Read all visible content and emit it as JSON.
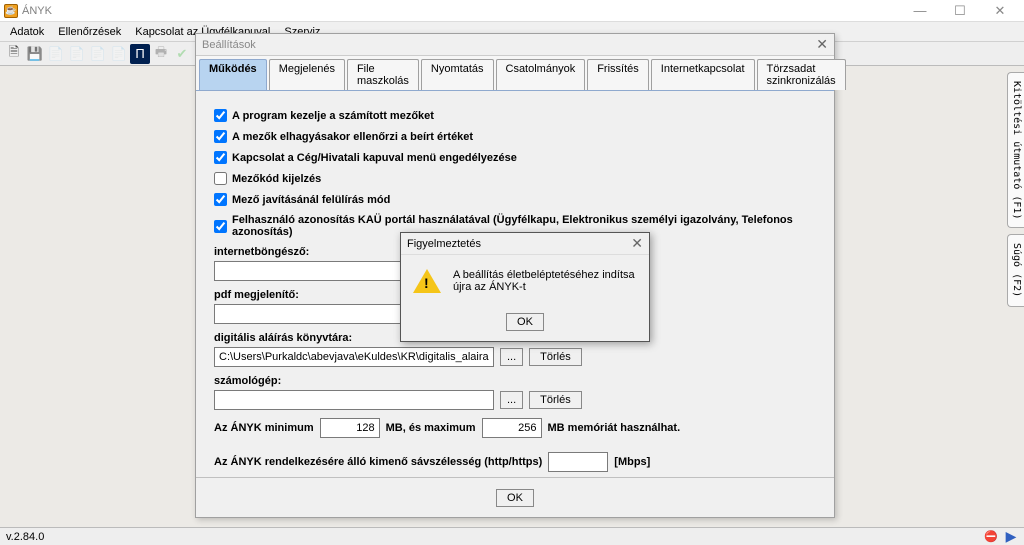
{
  "window": {
    "title": "ÁNYK"
  },
  "menubar": {
    "items": [
      "Adatok",
      "Ellenőrzések",
      "Kapcsolat az Ügyfélkapuval",
      "Szerviz"
    ]
  },
  "dialog": {
    "title": "Beállítások",
    "tabs": [
      "Működés",
      "Megjelenés",
      "File maszkolás",
      "Nyomtatás",
      "Csatolmányok",
      "Frissítés",
      "Internetkapcsolat",
      "Törzsadat szinkronizálás"
    ],
    "checkboxes": {
      "c0": "A program kezelje a számított mezőket",
      "c1": "A mezők elhagyásakor ellenőrzi a beírt értéket",
      "c2": "Kapcsolat a Cég/Hivatali kapuval menü engedélyezése",
      "c3": "Mezőkód kijelzés",
      "c4": "Mező javításánál felülírás mód",
      "c5": "Felhasználó azonosítás KAÜ portál használatával (Ügyfélkapu, Elektronikus személyi igazolvány, Telefonos azonosítás)"
    },
    "labels": {
      "browser": "internetböngésző:",
      "pdf": "pdf megjelenítő:",
      "sign": "digitális aláírás könyvtára:",
      "calc": "számológép:",
      "browse": "...",
      "delete": "Törlés",
      "mem_prefix": "Az ÁNYK minimum",
      "mem_mid": "MB, és maximum",
      "mem_suffix": "MB memóriát használhat.",
      "bw_label": "Az ÁNYK rendelkezésére álló kimenő sávszélesség (http/https)",
      "bw_unit": "[Mbps]",
      "ok": "OK"
    },
    "values": {
      "browser": "",
      "pdf": "",
      "sign": "C:\\Users\\Purkaldc\\abevjava\\eKuldes\\KR\\digitalis_alairas",
      "calc": "",
      "mem_min": "128",
      "mem_max": "256",
      "bw": ""
    }
  },
  "alert": {
    "title": "Figyelmeztetés",
    "message": "A beállítás életbeléptetéséhez indítsa újra az ÁNYK-t",
    "ok": "OK"
  },
  "right_tabs": {
    "t0": "Kitöltési útmutató (F1)",
    "t1": "Súgó (F2)"
  },
  "statusbar": {
    "version": "v.2.84.0"
  }
}
